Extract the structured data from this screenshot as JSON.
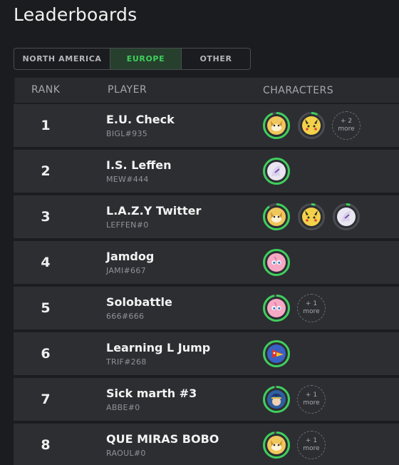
{
  "page": {
    "title": "Leaderboards"
  },
  "region_tabs": [
    {
      "label": "NORTH AMERICA",
      "active": false
    },
    {
      "label": "EUROPE",
      "active": true
    },
    {
      "label": "OTHER",
      "active": false
    }
  ],
  "columns": {
    "rank": "RANK",
    "player": "PLAYER",
    "characters": "CHARACTERS"
  },
  "colors": {
    "accent": "#3fcf5c",
    "ring_track": "#4a4c52"
  },
  "rows": [
    {
      "rank": "1",
      "name": "E.U. Check",
      "tag": "BIGL#935",
      "characters": [
        {
          "icon": "fox-icon",
          "usage": 0.95,
          "bg": "#f0c75c"
        },
        {
          "icon": "pikachu-icon",
          "usage": 0.08,
          "bg": "#f3d24a"
        }
      ],
      "more": {
        "count": "+ 2",
        "label": "more"
      }
    },
    {
      "rank": "2",
      "name": "I.S. Leffen",
      "tag": "MEW#444",
      "characters": [
        {
          "icon": "mewtwo-icon",
          "usage": 1.0,
          "bg": "#e9e6f2"
        }
      ],
      "more": null
    },
    {
      "rank": "3",
      "name": "L.A.Z.Y Twitter",
      "tag": "LEFFEN#0",
      "characters": [
        {
          "icon": "fox-icon",
          "usage": 0.9,
          "bg": "#f0c75c"
        },
        {
          "icon": "pikachu-icon",
          "usage": 0.05,
          "bg": "#f3d24a"
        },
        {
          "icon": "mewtwo-icon",
          "usage": 0.05,
          "bg": "#e9e6f2"
        }
      ],
      "more": null
    },
    {
      "rank": "4",
      "name": "Jamdog",
      "tag": "JAMI#667",
      "characters": [
        {
          "icon": "jigglypuff-icon",
          "usage": 1.0,
          "bg": "#f5a9c4"
        }
      ],
      "more": null
    },
    {
      "rank": "5",
      "name": "Solobattle",
      "tag": "666#666",
      "characters": [
        {
          "icon": "jigglypuff-icon",
          "usage": 0.97,
          "bg": "#f5a9c4"
        }
      ],
      "more": {
        "count": "+ 1",
        "label": "more"
      }
    },
    {
      "rank": "6",
      "name": "Learning L Jump",
      "tag": "TRIF#268",
      "characters": [
        {
          "icon": "falco-icon",
          "usage": 1.0,
          "bg": "#3a62c4"
        }
      ],
      "more": null
    },
    {
      "rank": "7",
      "name": "Sick marth #3",
      "tag": "ABBE#0",
      "characters": [
        {
          "icon": "marth-icon",
          "usage": 0.97,
          "bg": "#2f5fa0"
        }
      ],
      "more": {
        "count": "+ 1",
        "label": "more"
      }
    },
    {
      "rank": "8",
      "name": "QUE MIRAS BOBO",
      "tag": "RAOUL#0",
      "characters": [
        {
          "icon": "fox-icon",
          "usage": 0.97,
          "bg": "#f0c75c"
        }
      ],
      "more": {
        "count": "+ 1",
        "label": "more"
      }
    }
  ]
}
